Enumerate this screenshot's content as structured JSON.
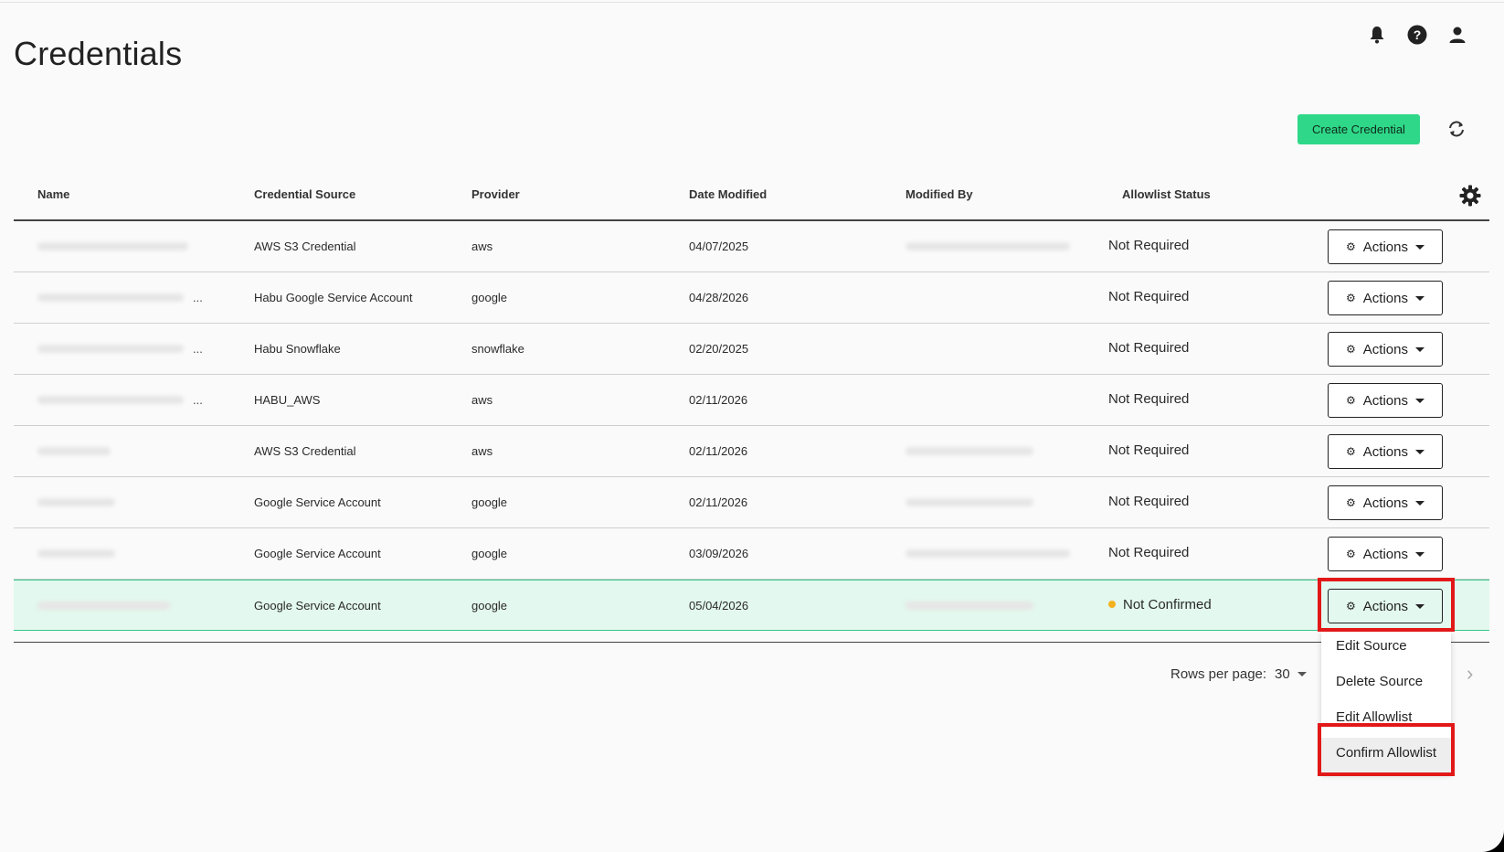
{
  "page": {
    "title": "Credentials"
  },
  "header_icons": [
    "bell-icon",
    "help-icon",
    "user-icon"
  ],
  "toolbar": {
    "create_label": "Create Credential",
    "refresh_icon": "refresh-icon"
  },
  "table": {
    "columns": [
      "Name",
      "Credential Source",
      "Provider",
      "Date Modified",
      "Modified By",
      "Allowlist Status"
    ],
    "settings_icon": "gear-icon",
    "action_label": "Actions",
    "rows": [
      {
        "source": "AWS S3 Credential",
        "provider": "aws",
        "date": "04/07/2025",
        "status": "Not Required"
      },
      {
        "source": "Habu Google Service Account",
        "provider": "google",
        "date": "04/28/2026",
        "status": "Not Required",
        "ellipsis": "..."
      },
      {
        "source": "Habu Snowflake",
        "provider": "snowflake",
        "date": "02/20/2025",
        "status": "Not Required",
        "ellipsis": "..."
      },
      {
        "source": "HABU_AWS",
        "provider": "aws",
        "date": "02/11/2026",
        "status": "Not Required",
        "ellipsis": "..."
      },
      {
        "source": "AWS S3 Credential",
        "provider": "aws",
        "date": "02/11/2026",
        "status": "Not Required"
      },
      {
        "source": "Google Service Account",
        "provider": "google",
        "date": "02/11/2026",
        "status": "Not Required"
      },
      {
        "source": "Google Service Account",
        "provider": "google",
        "date": "03/09/2026",
        "status": "Not Required"
      },
      {
        "source": "Google Service Account",
        "provider": "google",
        "date": "05/04/2026",
        "status": "Not Confirmed",
        "status_color": "#f2b21f"
      }
    ]
  },
  "pagination": {
    "rows_label": "Rows per page:",
    "rows_value": "30"
  },
  "menu": {
    "items": [
      "Edit Source",
      "Delete Source",
      "Edit Allowlist",
      "Confirm Allowlist"
    ]
  },
  "colors": {
    "accent": "#2fd888",
    "highlight_row": "#e3f8ee",
    "annotation": "#e21818"
  }
}
